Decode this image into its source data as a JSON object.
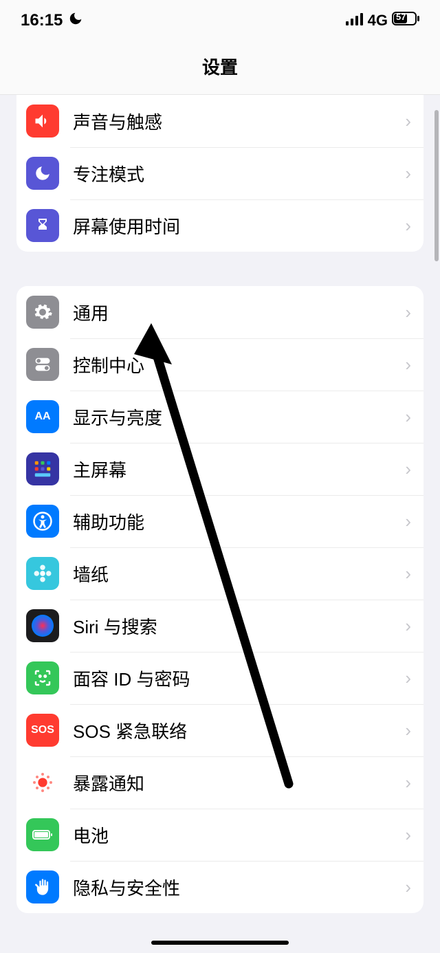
{
  "status": {
    "time": "16:15",
    "focus_icon": "moon",
    "signal": "4 bars",
    "network": "4G",
    "battery": "57"
  },
  "nav": {
    "title": "设置"
  },
  "group1": [
    {
      "label": "声音与触感",
      "icon": "speaker",
      "bg": "#ff3b30"
    },
    {
      "label": "专注模式",
      "icon": "moon",
      "bg": "#5856d6"
    },
    {
      "label": "屏幕使用时间",
      "icon": "hourglass",
      "bg": "#5856d6"
    }
  ],
  "group2": [
    {
      "label": "通用",
      "icon": "gear",
      "bg": "#8e8e93"
    },
    {
      "label": "控制中心",
      "icon": "switches",
      "bg": "#8e8e93"
    },
    {
      "label": "显示与亮度",
      "icon": "AA",
      "bg": "#007aff"
    },
    {
      "label": "主屏幕",
      "icon": "grid",
      "bg": "#3634a3"
    },
    {
      "label": "辅助功能",
      "icon": "access",
      "bg": "#007aff"
    },
    {
      "label": "墙纸",
      "icon": "flower",
      "bg": "#36c7de"
    },
    {
      "label": "Siri 与搜索",
      "icon": "siri",
      "bg": "#1c1c1e"
    },
    {
      "label": "面容 ID 与密码",
      "icon": "face",
      "bg": "#34c759"
    },
    {
      "label": "SOS 紧急联络",
      "icon": "SOS",
      "bg": "#ff3b30"
    },
    {
      "label": "暴露通知",
      "icon": "exposure",
      "bg": "#ffffff"
    },
    {
      "label": "电池",
      "icon": "battery",
      "bg": "#34c759"
    },
    {
      "label": "隐私与安全性",
      "icon": "hand",
      "bg": "#007aff"
    }
  ],
  "annotation": {
    "arrow_target": "通用"
  }
}
